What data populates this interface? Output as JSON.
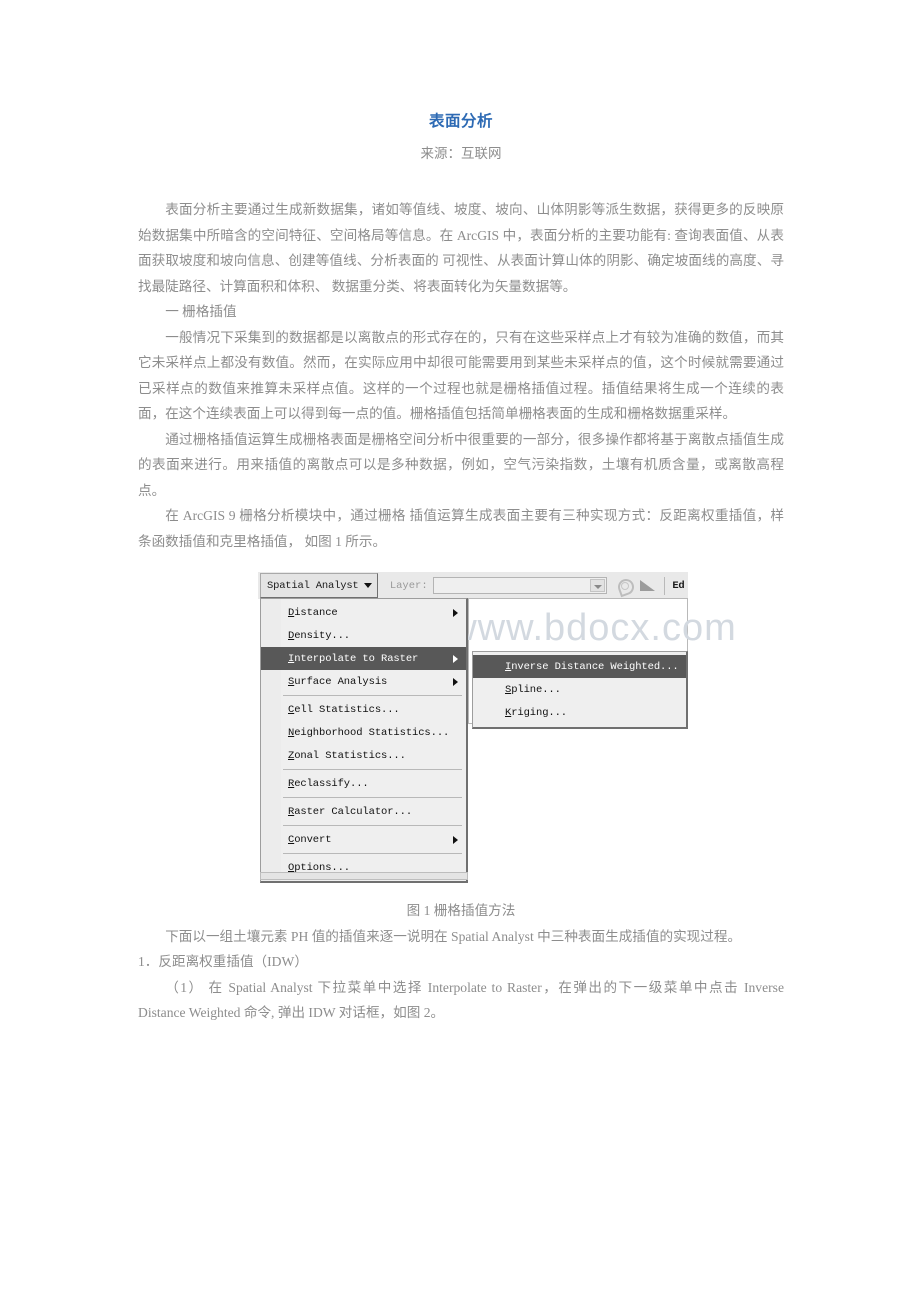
{
  "document": {
    "title": "表面分析",
    "source": "来源：互联网",
    "title_color": "#2d6ab4",
    "body_color": "#8d8d8d",
    "paragraphs": [
      "表面分析主要通过生成新数据集，诸如等值线、坡度、坡向、山体阴影等派生数据，获得更多的反映原始数据集中所暗含的空间特征、空间格局等信息。在 ArcGIS 中，表面分析的主要功能有: 查询表面值、从表面获取坡度和坡向信息、创建等值线、分析表面的 可视性、从表面计算山体的阴影、确定坡面线的高度、寻找最陡路径、计算面积和体积、 数据重分类、将表面转化为矢量数据等。",
      "一 栅格插值",
      "一般情况下采集到的数据都是以离散点的形式存在的，只有在这些采样点上才有较为准确的数值，而其它未采样点上都没有数值。然而，在实际应用中却很可能需要用到某些未采样点的值，这个时候就需要通过已采样点的数值来推算未采样点值。这样的一个过程也就是栅格插值过程。插值结果将生成一个连续的表面，在这个连续表面上可以得到每一点的值。栅格插值包括简单栅格表面的生成和栅格数据重采样。",
      "通过栅格插值运算生成栅格表面是栅格空间分析中很重要的一部分，很多操作都将基于离散点插值生成的表面来进行。用来插值的离散点可以是多种数据，例如，空气污染指数，土壤有机质含量，或离散高程点。",
      "在 ArcGIS 9 栅格分析模块中，通过栅格 插值运算生成表面主要有三种实现方式：反距离权重插值，样条函数插值和克里格插值， 如图 1 所示。"
    ],
    "figure_caption": "图 1 栅格插值方法",
    "paragraphs_after": [
      "下面以一组土壤元素 PH 值的插值来逐一说明在 Spatial Analyst 中三种表面生成插值的实现过程。",
      "1．反距离权重插值（IDW）",
      "（1） 在 Spatial Analyst 下拉菜单中选择 Interpolate to Raster，在弹出的下一级菜单中点击 Inverse Distance Weighted 命令, 弹出 IDW 对话框，如图 2。"
    ]
  },
  "figure": {
    "watermark": "www.bdocx.com",
    "toolbar": {
      "menu_button_label": "Spatial Analyst",
      "layer_label": "Layer:",
      "layer_value": "",
      "edit_label": "Ed",
      "dropdown_icon": "caret-down-icon",
      "histogram_icon": "histogram-icon",
      "hillshade_icon": "hillshade-icon"
    },
    "menu": {
      "items": [
        {
          "label": "Distance",
          "submenu": true,
          "selected": false,
          "divider_after": false
        },
        {
          "label": "Density...",
          "submenu": false,
          "selected": false,
          "divider_after": false
        },
        {
          "label": "Interpolate to Raster",
          "submenu": true,
          "selected": true,
          "divider_after": false
        },
        {
          "label": "Surface Analysis",
          "submenu": true,
          "selected": false,
          "divider_after": true
        },
        {
          "label": "Cell Statistics...",
          "submenu": false,
          "selected": false,
          "divider_after": false
        },
        {
          "label": "Neighborhood Statistics...",
          "submenu": false,
          "selected": false,
          "divider_after": false
        },
        {
          "label": "Zonal Statistics...",
          "submenu": false,
          "selected": false,
          "divider_after": true
        },
        {
          "label": "Reclassify...",
          "submenu": false,
          "selected": false,
          "divider_after": true
        },
        {
          "label": "Raster Calculator...",
          "submenu": false,
          "selected": false,
          "divider_after": true
        },
        {
          "label": "Convert",
          "submenu": true,
          "selected": false,
          "divider_after": true
        },
        {
          "label": "Options...",
          "submenu": false,
          "selected": false,
          "divider_after": false
        }
      ]
    },
    "submenu": {
      "items": [
        {
          "label": "Inverse Distance Weighted...",
          "selected": true
        },
        {
          "label": "Spline...",
          "selected": false
        },
        {
          "label": "Kriging...",
          "selected": false
        }
      ]
    },
    "colors": {
      "menu_bg": "#efefef",
      "menu_selected_bg": "#585858",
      "menu_selected_fg": "#ffffff",
      "toolbar_bg": "#e9e9e9",
      "watermark": "#d3d9e0"
    }
  }
}
